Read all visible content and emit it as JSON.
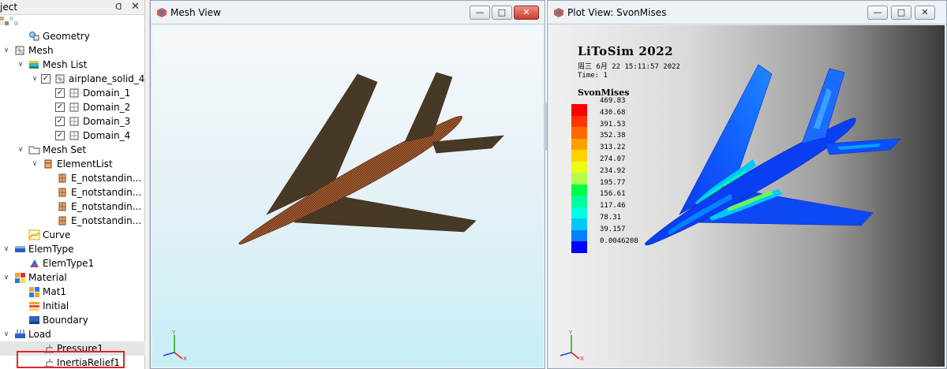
{
  "project": {
    "title": "ject",
    "pin_glyph": "ᗡ",
    "close_glyph": "✕"
  },
  "tree": [
    {
      "level": 1,
      "expander": "",
      "checkbox": false,
      "icon": "geometry-icon",
      "label": "Geometry"
    },
    {
      "level": 0,
      "expander": "v",
      "checkbox": false,
      "icon": "mesh-icon",
      "label": "Mesh"
    },
    {
      "level": 1,
      "expander": "v",
      "checkbox": false,
      "icon": "mesh-list-icon",
      "label": "Mesh List"
    },
    {
      "level": 2,
      "expander": "v",
      "checkbox": true,
      "icon": "part-icon",
      "label": "airplane_solid_4"
    },
    {
      "level": 3,
      "expander": "",
      "checkbox": true,
      "icon": "domain-icon",
      "label": "Domain_1"
    },
    {
      "level": 3,
      "expander": "",
      "checkbox": true,
      "icon": "domain-icon",
      "label": "Domain_2"
    },
    {
      "level": 3,
      "expander": "",
      "checkbox": true,
      "icon": "domain-icon",
      "label": "Domain_3"
    },
    {
      "level": 3,
      "expander": "",
      "checkbox": true,
      "icon": "domain-icon",
      "label": "Domain_4"
    },
    {
      "level": 1,
      "expander": "v",
      "checkbox": false,
      "icon": "folder-icon",
      "label": "Mesh Set"
    },
    {
      "level": 2,
      "expander": "v",
      "checkbox": false,
      "icon": "element-list-icon",
      "label": "ElementList"
    },
    {
      "level": 3,
      "expander": "",
      "checkbox": false,
      "icon": "element-set-icon",
      "label": "E_notstandin..."
    },
    {
      "level": 3,
      "expander": "",
      "checkbox": false,
      "icon": "element-set-icon",
      "label": "E_notstandin..."
    },
    {
      "level": 3,
      "expander": "",
      "checkbox": false,
      "icon": "element-set-icon",
      "label": "E_notstandin..."
    },
    {
      "level": 3,
      "expander": "",
      "checkbox": false,
      "icon": "element-set-icon",
      "label": "E_notstandin..."
    },
    {
      "level": 1,
      "expander": "",
      "checkbox": false,
      "icon": "curve-icon",
      "label": "Curve"
    },
    {
      "level": 0,
      "expander": "v",
      "checkbox": false,
      "icon": "elemtype-icon",
      "label": "ElemType"
    },
    {
      "level": 1,
      "expander": "",
      "checkbox": false,
      "icon": "elemtype-item-icon",
      "label": "ElemType1"
    },
    {
      "level": 0,
      "expander": "v",
      "checkbox": false,
      "icon": "material-icon",
      "label": "Material"
    },
    {
      "level": 1,
      "expander": "",
      "checkbox": false,
      "icon": "material-item-icon",
      "label": "Mat1"
    },
    {
      "level": 1,
      "expander": "",
      "checkbox": false,
      "icon": "initial-icon",
      "label": "Initial"
    },
    {
      "level": 1,
      "expander": "",
      "checkbox": false,
      "icon": "boundary-icon",
      "label": "Boundary"
    },
    {
      "level": 0,
      "expander": "v",
      "checkbox": false,
      "icon": "load-icon",
      "label": "Load"
    },
    {
      "level": 2,
      "expander": "",
      "checkbox": false,
      "icon": "load-item-icon",
      "label": "Pressure1",
      "selected": true
    },
    {
      "level": 2,
      "expander": "",
      "checkbox": false,
      "icon": "load-item-icon",
      "label": "InertiaRelief1",
      "highlighted": true
    }
  ],
  "mesh_view": {
    "title": "Mesh View",
    "buttons": {
      "minimize": "—",
      "maximize": "□",
      "close": "✕"
    }
  },
  "plot_view": {
    "title": "Plot View: SvonMises",
    "buttons": {
      "minimize": "—",
      "maximize": "□",
      "close": "✕"
    },
    "heading": "LiToSim 2022",
    "date": "周三 6月 22 15:11:57 2022",
    "time": "Time: 1",
    "legend_title": "SvonMises",
    "legend_values": [
      "469.83",
      "430.68",
      "391.53",
      "352.38",
      "313.22",
      "274.07",
      "234.92",
      "195.77",
      "156.61",
      "117.46",
      "78.31",
      "39.157",
      "0.0046208"
    ],
    "legend_colors": [
      "#ff0000",
      "#ff3500",
      "#ff6a00",
      "#ff9f00",
      "#ffd400",
      "#e9ff16",
      "#b4ff4b",
      "#00ff40",
      "#00ff9f",
      "#00ffe0",
      "#00c8ff",
      "#0080ff",
      "#0000ff"
    ]
  },
  "axes": {
    "y": "Y",
    "x": "X"
  }
}
